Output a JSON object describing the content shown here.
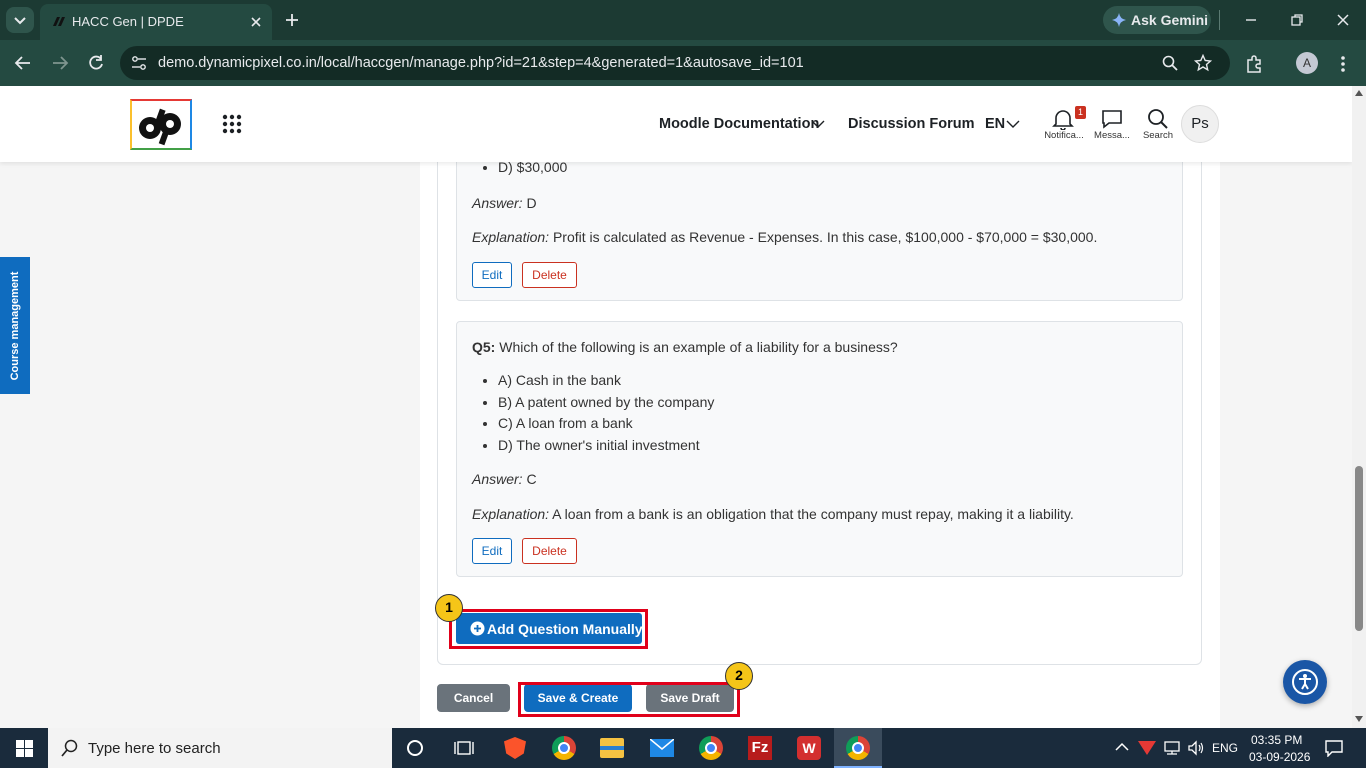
{
  "browser": {
    "tab_title": "HACC Gen | DPDE",
    "url": "demo.dynamicpixel.co.in/local/haccgen/manage.php?id=21&step=4&generated=1&autosave_id=101",
    "gemini_label": "Ask Gemini",
    "profile_initial": "A"
  },
  "navbar": {
    "doc_link": "Moodle Documentation",
    "forum_link": "Discussion Forum",
    "lang": "EN",
    "notif_count": "1",
    "notif_label": "Notifica...",
    "messages_label": "Messa...",
    "search_label": "Search",
    "user_initials": "Ps"
  },
  "sidebar": {
    "tab_label": "Course management"
  },
  "q4": {
    "option_d": "D) $30,000",
    "answer_label": "Answer:",
    "answer": " D",
    "explanation_label": "Explanation:",
    "explanation": " Profit is calculated as Revenue - Expenses. In this case, $100,000 - $70,000 = $30,000.",
    "edit": "Edit",
    "delete": "Delete"
  },
  "q5": {
    "number": "Q5:",
    "question": " Which of the following is an example of a liability for a business?",
    "options": [
      "A) Cash in the bank",
      "B) A patent owned by the company",
      "C) A loan from a bank",
      "D) The owner's initial investment"
    ],
    "answer_label": "Answer:",
    "answer": " C",
    "explanation_label": "Explanation:",
    "explanation": " A loan from a bank is an obligation that the company must repay, making it a liability.",
    "edit": "Edit",
    "delete": "Delete"
  },
  "actions": {
    "add_question": "Add Question Manually",
    "cancel": "Cancel",
    "save_create": "Save & Create",
    "save_draft": "Save Draft"
  },
  "annotations": {
    "badge1": "1",
    "badge2": "2"
  },
  "taskbar": {
    "search_placeholder": "Type here to search",
    "lang": "ENG",
    "time": "03:35 PM",
    "date": "03-09-2026"
  },
  "colors": {
    "primary": "#0f6cbf",
    "danger": "#ca3120",
    "annotation_red": "#e0001a",
    "annotation_badge": "#f5c518"
  }
}
